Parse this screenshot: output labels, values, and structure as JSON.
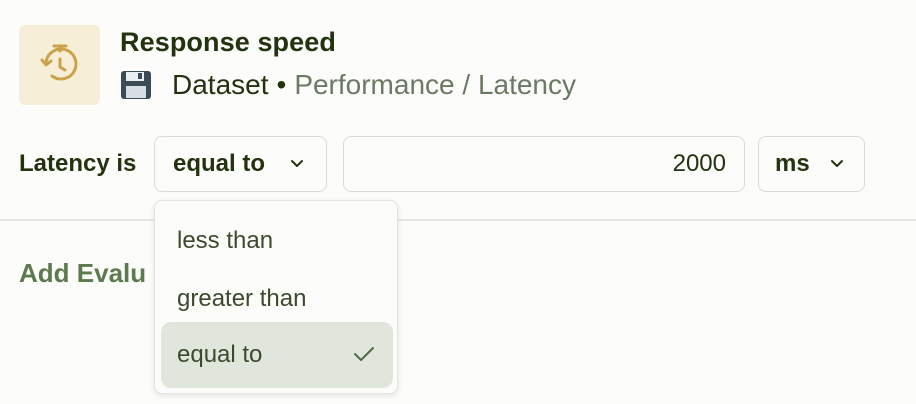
{
  "header": {
    "icon": "timer-reset-icon",
    "title": "Response speed",
    "source_icon": "floppy-disk-icon",
    "source": "Dataset",
    "separator": "•",
    "category": "Performance / Latency"
  },
  "filter": {
    "label": "Latency is",
    "operator": "equal to",
    "value": "2000",
    "unit": "ms"
  },
  "add_evaluator": "Add Evalu",
  "dropdown": {
    "options": [
      "less than",
      "greater than",
      "equal to"
    ],
    "selected": "equal to"
  },
  "colors": {
    "accent": "#c9a24a",
    "text_dark": "#23330f",
    "muted": "#6b7a63",
    "link_green": "#5c7a4e",
    "selected_bg": "#e0e6db"
  }
}
